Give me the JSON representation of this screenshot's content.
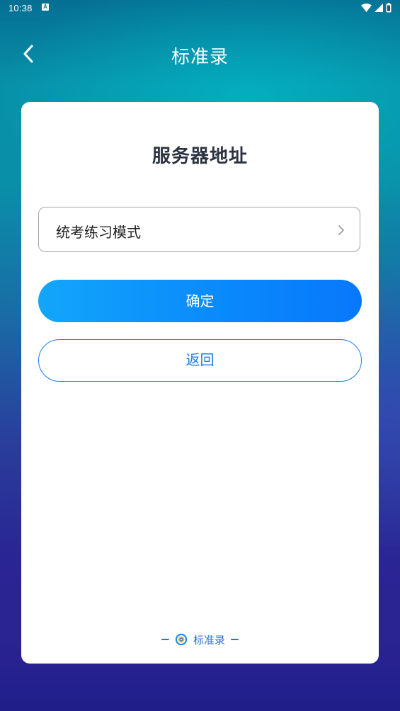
{
  "status_bar": {
    "time": "10:38",
    "notification_icon": "a-notification-icon",
    "icons": [
      "wifi-icon",
      "cellular-signal-icon",
      "battery-icon"
    ]
  },
  "header": {
    "back_icon": "chevron-left-icon",
    "title": "标准录"
  },
  "card": {
    "title": "服务器地址",
    "select": {
      "value": "统考练习模式",
      "arrow_icon": "chevron-right-icon"
    },
    "confirm_label": "确定",
    "return_label": "返回",
    "footer": {
      "logo_icon": "app-logo-icon",
      "text": "标准录"
    }
  },
  "colors": {
    "accent": "#0b8cfb",
    "outline_blue": "#1e7fe3",
    "title_text": "#2c3340"
  }
}
